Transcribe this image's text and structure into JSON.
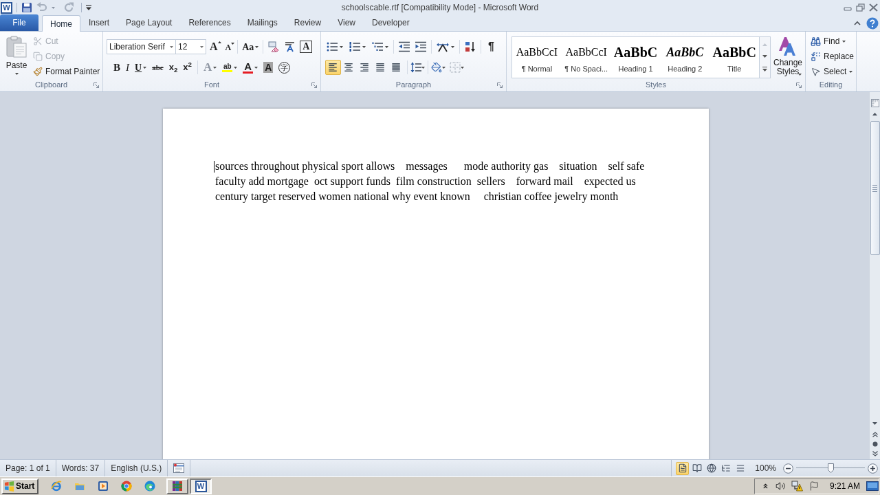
{
  "window": {
    "logo": "W",
    "title": "schoolscable.rtf [Compatibility Mode] - Microsoft Word"
  },
  "quick_access": {
    "undo": {
      "disabled": true
    },
    "redo": {
      "disabled": true
    }
  },
  "tabs": [
    {
      "label": "File",
      "kind": "backstage",
      "selected": false
    },
    {
      "label": "Home",
      "kind": "tab",
      "selected": true
    },
    {
      "label": "Insert",
      "kind": "tab",
      "selected": false
    },
    {
      "label": "Page Layout",
      "kind": "tab",
      "selected": false
    },
    {
      "label": "References",
      "kind": "tab",
      "selected": false
    },
    {
      "label": "Mailings",
      "kind": "tab",
      "selected": false
    },
    {
      "label": "Review",
      "kind": "tab",
      "selected": false
    },
    {
      "label": "View",
      "kind": "tab",
      "selected": false
    },
    {
      "label": "Developer",
      "kind": "tab",
      "selected": false
    }
  ],
  "ribbon": {
    "clipboard": {
      "label": "Clipboard",
      "paste": "Paste",
      "cut": {
        "label": "Cut",
        "disabled": true
      },
      "copy": {
        "label": "Copy",
        "disabled": true
      },
      "format_painter": {
        "label": "Format Painter",
        "disabled": false
      }
    },
    "font": {
      "label": "Font",
      "font_name": "Liberation Serif",
      "font_size": "12",
      "grow": "A",
      "shrink": "A",
      "change_case": "Aa",
      "border": "A",
      "format_buttons": [
        {
          "glyph": "B",
          "kind": "bold",
          "disabled": false
        },
        {
          "glyph": "I",
          "kind": "italic",
          "disabled": false
        },
        {
          "glyph": "U",
          "kind": "underline",
          "disabled": false
        },
        {
          "glyph": "abc",
          "kind": "strikethrough",
          "disabled": false
        },
        {
          "glyph": "x$_{2}$",
          "kind": "subscript",
          "disabled": false
        },
        {
          "glyph": "x$^{2}$",
          "kind": "superscript",
          "disabled": false
        },
        {
          "glyph": "A",
          "kind": "text_effects",
          "disabled": true
        },
        {
          "glyph": "ab",
          "kind": "highlight",
          "disabled": false
        },
        {
          "glyph": "A",
          "kind": "font_color",
          "disabled": false
        },
        {
          "glyph": "A",
          "kind": "shading",
          "disabled": false
        },
        {
          "glyph": "字",
          "kind": "enclose",
          "disabled": false
        }
      ]
    },
    "paragraph": {
      "label": "Paragraph",
      "show_marks": "¶",
      "alignments": [
        {
          "kind": "left",
          "selected": true
        },
        {
          "kind": "center",
          "selected": false
        },
        {
          "kind": "right",
          "selected": false
        },
        {
          "kind": "justify",
          "selected": false
        },
        {
          "kind": "distributed",
          "selected": false
        }
      ]
    },
    "styles": {
      "label": "Styles",
      "gallery": [
        {
          "preview": "AaBbCcI",
          "name": "¶ Normal",
          "kind": "normal"
        },
        {
          "preview": "AaBbCcI",
          "name": "¶ No Spaci...",
          "kind": "normal"
        },
        {
          "preview": "AaBbC",
          "name": "Heading 1",
          "kind": "heading1"
        },
        {
          "preview": "AaBbC",
          "name": "Heading 2",
          "kind": "heading2"
        },
        {
          "preview": "AaBbC",
          "name": "Title",
          "kind": "title"
        }
      ],
      "change_styles": "Change Styles"
    },
    "editing": {
      "label": "Editing",
      "items": [
        {
          "label": "Find",
          "kind": "find"
        },
        {
          "label": "Replace",
          "kind": "replace"
        },
        {
          "label": "Select",
          "kind": "select"
        }
      ]
    }
  },
  "document": {
    "lines": [
      "sources throughout physical sport allows    messages      mode authority gas    situation    self safe",
      "faculty add mortgage  oct support funds  film construction  sellers    forward mail    expected us",
      "century target reserved women national why event known     christian coffee jewelry month"
    ]
  },
  "status_bar": {
    "items": [
      "Page: 1 of 1",
      "Words: 37",
      "English (U.S.)"
    ],
    "views": [
      {
        "kind": "print_layout",
        "selected": true
      },
      {
        "kind": "full_screen_reading",
        "selected": false
      },
      {
        "kind": "web_layout",
        "selected": false
      },
      {
        "kind": "outline",
        "selected": false
      },
      {
        "kind": "draft",
        "selected": false
      }
    ],
    "zoom": "100%",
    "zoom_slider": {
      "level": 0.5
    }
  },
  "taskbar": {
    "start": "Start",
    "windows": [
      {
        "kind": "archive",
        "selected": false
      },
      {
        "kind": "document_app",
        "glyph": "W",
        "selected": true
      }
    ],
    "clock": "9:21 AM"
  }
}
